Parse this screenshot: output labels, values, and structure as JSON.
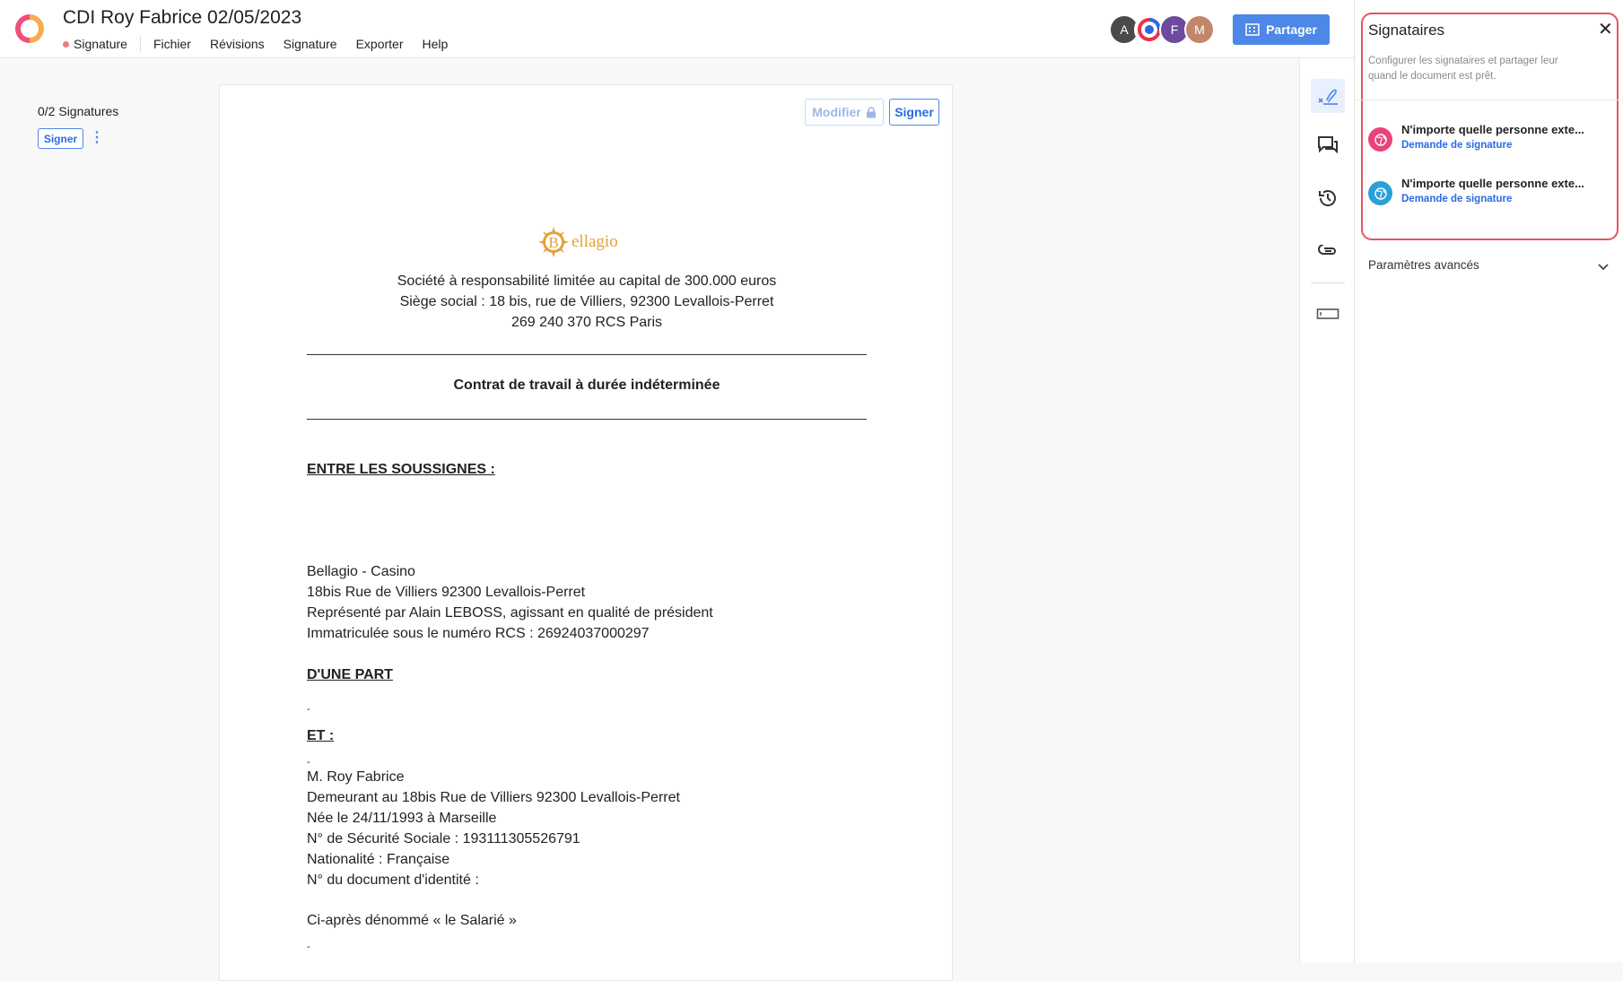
{
  "header": {
    "title": "CDI Roy Fabrice 02/05/2023",
    "status": "Signature",
    "menu": [
      "Fichier",
      "Révisions",
      "Signature",
      "Exporter",
      "Help"
    ],
    "avatars": [
      {
        "letter": "A",
        "color": "#4a4a4a"
      },
      {
        "letter": "",
        "color": "#ffffff"
      },
      {
        "letter": "F",
        "color": "#6e4a9e"
      },
      {
        "letter": "M",
        "color": "#c2876a"
      }
    ],
    "share_label": "Partager"
  },
  "left": {
    "count": "0/2 Signatures",
    "sign_label": "Signer",
    "more": "⋮"
  },
  "document": {
    "modifier_label": "Modifier",
    "signer_label": "Signer",
    "brand_letter": "B",
    "brand_name": "ellagio",
    "company_lines": [
      "Société à responsabilité limitée au capital de 300.000 euros",
      "Siège social : 18 bis, rue de Villiers, 92300 Levallois-Perret",
      "269 240 370 RCS Paris"
    ],
    "contract_title": "Contrat de travail à durée indéterminée",
    "entre": "ENTRE LES SOUSSIGNES :",
    "employer_lines": [
      "Bellagio - Casino",
      "18bis Rue de Villiers 92300 Levallois-Perret",
      "Représenté par Alain LEBOSS, agissant en qualité de président",
      "Immatriculée sous le numéro RCS : 26924037000297"
    ],
    "une_part": "D'UNE PART",
    "dash": "-",
    "et": "ET :",
    "employee_lines": [
      "M. Roy Fabrice",
      "Demeurant au 18bis Rue de Villiers 92300 Levallois-Perret",
      "Née le 24/11/1993 à Marseille",
      "N° de Sécurité Sociale : 193111305526791",
      "Nationalité : Française",
      "N° du document d'identité :"
    ],
    "salarie": "Ci-après dénommé « le Salarié »"
  },
  "panel": {
    "title": "Signataires",
    "description": "Configurer les signataires et partager leur quand le document est prêt.",
    "signees": [
      {
        "name": "N'importe quelle personne exte...",
        "request": "Demande de signature",
        "color": "#e8447a"
      },
      {
        "name": "N'importe quelle personne exte...",
        "request": "Demande de signature",
        "color": "#2a9fd8"
      }
    ],
    "advanced": "Paramètres avancés"
  },
  "icons": {
    "close": "close-icon",
    "chevron": "chevron-down-icon"
  }
}
